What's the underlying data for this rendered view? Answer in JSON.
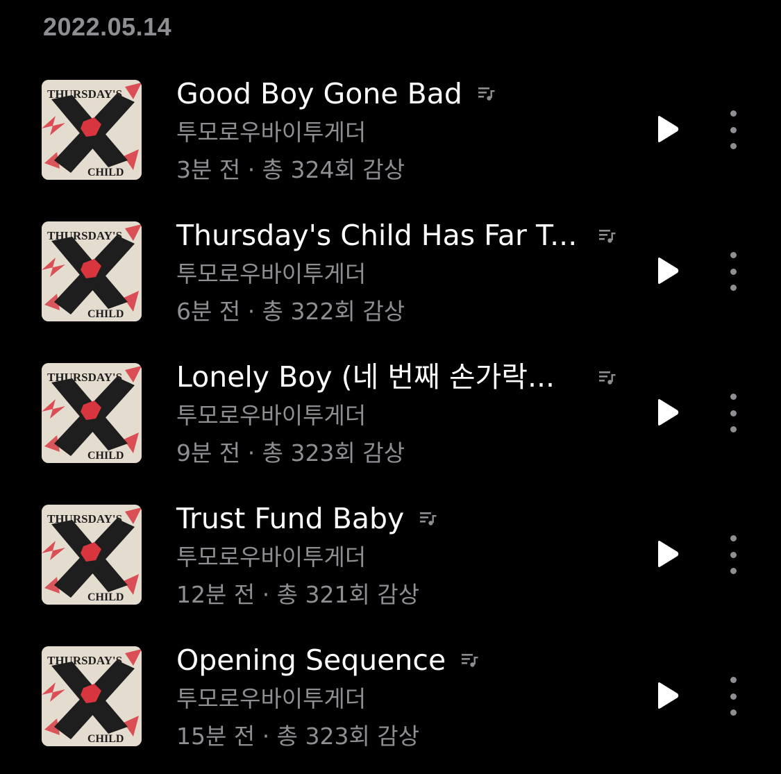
{
  "section": {
    "date": "2022.05.14"
  },
  "tracks": [
    {
      "title": "Good Boy Gone Bad",
      "artist": "투모로우바이투게더",
      "meta": "3분 전 · 총 324회 감상"
    },
    {
      "title": "Thursday's Child Has Far T...",
      "artist": "투모로우바이투게더",
      "meta": "6분 전 · 총 322회 감상"
    },
    {
      "title": "Lonely Boy (네 번째 손가락...",
      "artist": "투모로우바이투게더",
      "meta": "9분 전 · 총 323회 감상"
    },
    {
      "title": "Trust Fund Baby",
      "artist": "투모로우바이투게더",
      "meta": "12분 전 · 총 321회 감상"
    },
    {
      "title": "Opening Sequence",
      "artist": "투모로우바이투게더",
      "meta": "15분 전 · 총 323회 감상"
    }
  ],
  "album_art": {
    "text_top": "THURSDAY'S",
    "text_bottom": "CHILD"
  },
  "icons": {
    "lyrics": "lyrics-icon",
    "play": "play-icon",
    "more": "more-vertical-icon"
  },
  "colors": {
    "background": "#000000",
    "primary_text": "#ffffff",
    "secondary_text": "#8e8e93",
    "album_bg": "#e4ddcf",
    "album_x": "#1e1e1e",
    "album_red": "#d8353f"
  }
}
